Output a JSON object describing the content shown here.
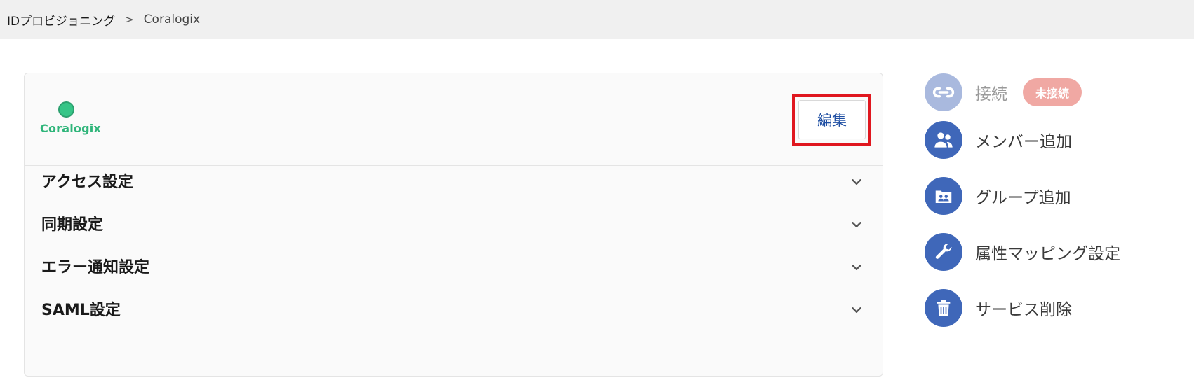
{
  "breadcrumb": {
    "root": "IDプロビジョニング",
    "separator": ">",
    "current": "Coralogix"
  },
  "service": {
    "logo_text": "Coralogix",
    "edit_label": "編集"
  },
  "sections": [
    {
      "label": "アクセス設定",
      "icon": "chevron-down-icon"
    },
    {
      "label": "同期設定",
      "icon": "chevron-down-icon"
    },
    {
      "label": "エラー通知設定",
      "icon": "chevron-down-icon"
    },
    {
      "label": "SAML設定",
      "icon": "chevron-down-icon"
    }
  ],
  "actions": [
    {
      "label": "接続",
      "icon": "link-icon",
      "badge": "未接続",
      "disabled": true
    },
    {
      "label": "メンバー追加",
      "icon": "people-icon"
    },
    {
      "label": "グループ追加",
      "icon": "group-folder-icon"
    },
    {
      "label": "属性マッピング設定",
      "icon": "wrench-icon"
    },
    {
      "label": "サービス削除",
      "icon": "trash-icon"
    }
  ],
  "colors": {
    "accent": "#3f67b9",
    "highlight": "#e0171f",
    "badge": "#f0a8a3",
    "logo": "#2fb57a"
  }
}
